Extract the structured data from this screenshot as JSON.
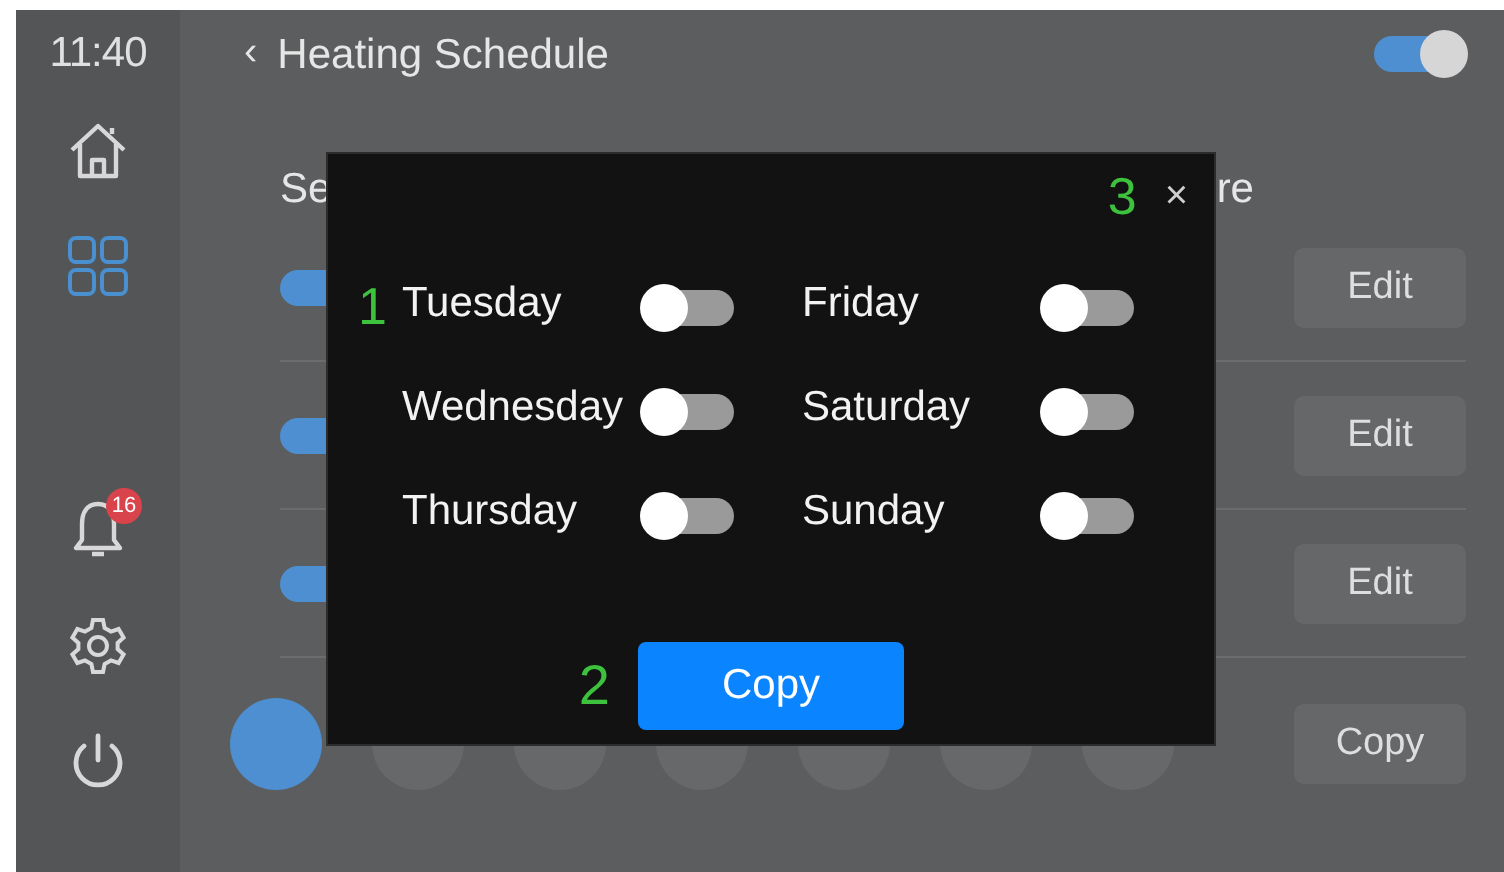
{
  "sidebar": {
    "time": "11:40",
    "items": [
      {
        "kind": "home",
        "selected": false
      },
      {
        "kind": "grid",
        "selected": true
      },
      {
        "kind": "bell",
        "badge": "16",
        "selected": false
      },
      {
        "kind": "gear",
        "selected": false
      },
      {
        "kind": "power",
        "selected": false
      }
    ]
  },
  "header": {
    "back": "‹",
    "title": "Heating Schedule",
    "toggle": {
      "on": true
    }
  },
  "schedule": {
    "heading_start": "Se",
    "heading_end": "re",
    "rows": [
      {
        "on": true,
        "button": "Edit"
      },
      {
        "on": true,
        "button": "Edit"
      },
      {
        "on": true,
        "button": "Edit"
      }
    ],
    "days": [
      {
        "selected": true
      },
      {
        "selected": false
      },
      {
        "selected": false
      },
      {
        "selected": false
      },
      {
        "selected": false
      },
      {
        "selected": false
      },
      {
        "selected": false
      }
    ],
    "copy_button": "Copy"
  },
  "dialog": {
    "close_marker": "3",
    "close": "×",
    "days_marker": "1",
    "days": [
      {
        "label": "Tuesday",
        "on": false
      },
      {
        "label": "Wednesday",
        "on": false
      },
      {
        "label": "Thursday",
        "on": false
      },
      {
        "label": "Friday",
        "on": false
      },
      {
        "label": "Saturday",
        "on": false
      },
      {
        "label": "Sunday",
        "on": false
      }
    ],
    "copy_marker": "2",
    "button": "Copy"
  }
}
